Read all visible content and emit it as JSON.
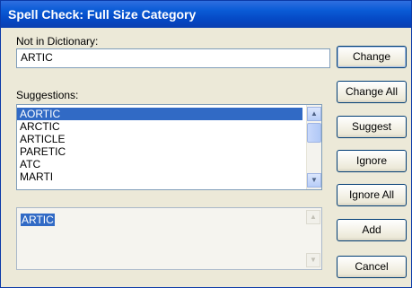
{
  "window": {
    "title": "Spell Check: Full Size Category"
  },
  "not_in_dictionary": {
    "label": "Not in Dictionary:",
    "value": "ARTIC"
  },
  "suggestions": {
    "label": "Suggestions:",
    "items": [
      "AORTIC",
      "ARCTIC",
      "ARTICLE",
      "PARETIC",
      "ATC",
      "MARTI"
    ],
    "selected": "AORTIC"
  },
  "editor": {
    "value": "ARTIC"
  },
  "buttons": {
    "change": "Change",
    "change_all": "Change All",
    "suggest": "Suggest",
    "ignore": "Ignore",
    "ignore_all": "Ignore All",
    "add": "Add",
    "cancel": "Cancel"
  },
  "icons": {
    "scroll_up": "scroll-up-arrow",
    "scroll_down": "scroll-down-arrow"
  }
}
